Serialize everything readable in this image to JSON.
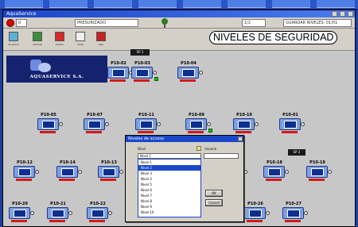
{
  "window": {
    "title": "AquaService",
    "statusbar": {
      "field_left": "0",
      "field_center": "PRESURIZADO",
      "field_mid": "1/2",
      "field_right": "GUARDAR NIVELES: 01/01"
    }
  },
  "toolbar": {
    "tools": [
      "Sinoptico",
      "Alarmas",
      "Grafico",
      "Vista",
      "Salir"
    ],
    "security_badge": "NIVELES DE SEGURIDAD"
  },
  "logo": {
    "name": "AQUASERVICE S.A."
  },
  "tags": [
    {
      "text": "SP 1"
    },
    {
      "text": "SP 2"
    },
    {
      "text": "SP 3"
    }
  ],
  "units": [
    {
      "name": "P10-02",
      "base": "red",
      "led": false
    },
    {
      "name": "P10-03",
      "base": "red",
      "led": true
    },
    {
      "name": "P10-04",
      "base": "red",
      "led": false
    },
    {
      "name": "P10-05",
      "base": "red",
      "led": false
    },
    {
      "name": "P10-07",
      "base": "red",
      "led": false
    },
    {
      "name": "P10-11",
      "base": "red",
      "led": false
    },
    {
      "name": "P10-09",
      "base": "red",
      "led": true
    },
    {
      "name": "P10-10",
      "base": "red",
      "led": false
    },
    {
      "name": "P10-01",
      "base": "red",
      "led": false
    },
    {
      "name": "P10-12",
      "base": "red",
      "led": false
    },
    {
      "name": "P10-14",
      "base": "red",
      "led": false
    },
    {
      "name": "P10-13",
      "base": "red",
      "led": false
    },
    {
      "name": "P10-15",
      "base": "red",
      "led": false
    },
    {
      "name": "P10-16",
      "base": "red",
      "led": false
    },
    {
      "name": "P10-17",
      "base": "red",
      "led": false
    },
    {
      "name": "P10-18",
      "base": "red",
      "led": false
    },
    {
      "name": "P10-19",
      "base": "red",
      "led": false
    },
    {
      "name": "P10-20",
      "base": "red",
      "led": false
    },
    {
      "name": "P10-21",
      "base": "red",
      "led": false
    },
    {
      "name": "P10-22",
      "base": "red",
      "led": false
    },
    {
      "name": "P10-23",
      "base": "gray",
      "led": false
    },
    {
      "name": "P10-24",
      "base": "red",
      "led": true
    },
    {
      "name": "P10-25",
      "base": "red",
      "led": false
    },
    {
      "name": "P10-26",
      "base": "red",
      "led": false
    },
    {
      "name": "P10-27",
      "base": "red",
      "led": false
    }
  ],
  "dialog": {
    "title": "Niveles de acceso",
    "level_label": "Nivel",
    "user_label": "Usuario",
    "selected": "Nivel 1",
    "options": [
      "Nivel 1",
      "Nivel 2",
      "Nivel 3",
      "Nivel 4",
      "Nivel 5",
      "Nivel 6",
      "Nivel 7",
      "Nivel 8",
      "Nivel 9",
      "Nivel 10"
    ],
    "selected_index": 1,
    "ok_label": "OK",
    "cancel_label": "Cancel"
  },
  "colors": {
    "brand_blue": "#15236e",
    "titlebar_blue": "#1b48c9",
    "alarm_red": "#d21a1a",
    "run_green": "#19c319"
  }
}
